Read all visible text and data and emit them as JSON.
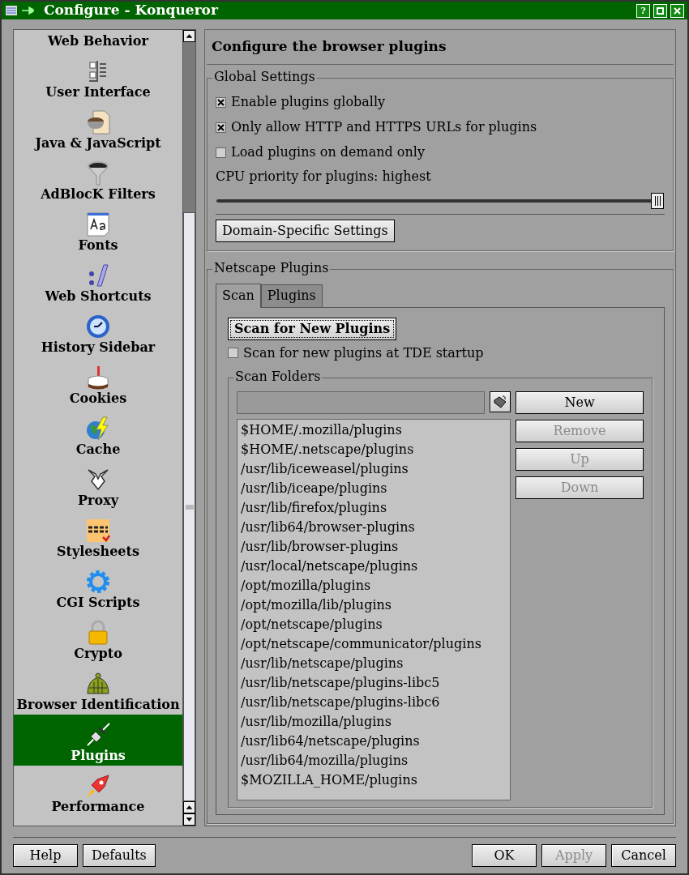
{
  "window": {
    "title": "Configure - Konqueror",
    "help_button": "?"
  },
  "sidebar": {
    "items": [
      {
        "label": "Web Behavior",
        "selected": false
      },
      {
        "label": "User Interface",
        "selected": false
      },
      {
        "label": "Java & JavaScript",
        "selected": false
      },
      {
        "label": "AdBlocK Filters",
        "selected": false
      },
      {
        "label": "Fonts",
        "selected": false
      },
      {
        "label": "Web Shortcuts",
        "selected": false
      },
      {
        "label": "History Sidebar",
        "selected": false
      },
      {
        "label": "Cookies",
        "selected": false
      },
      {
        "label": "Cache",
        "selected": false
      },
      {
        "label": "Proxy",
        "selected": false
      },
      {
        "label": "Stylesheets",
        "selected": false
      },
      {
        "label": "CGI Scripts",
        "selected": false
      },
      {
        "label": "Crypto",
        "selected": false
      },
      {
        "label": "Browser Identification",
        "selected": false
      },
      {
        "label": "Plugins",
        "selected": true
      },
      {
        "label": "Performance",
        "selected": false
      }
    ]
  },
  "page_title": "Configure the browser plugins",
  "global_settings": {
    "title": "Global Settings",
    "options": [
      {
        "label": "Enable plugins globally",
        "checked": true
      },
      {
        "label": "Only allow HTTP and HTTPS URLs for plugins",
        "checked": true
      },
      {
        "label": "Load plugins on demand only",
        "checked": false
      }
    ],
    "cpu_priority": {
      "label": "CPU priority for plugins: highest",
      "level": 1
    },
    "domain_button": "Domain-Specific Settings"
  },
  "netscape_plugins": {
    "title": "Netscape Plugins",
    "tabs": [
      {
        "label": "Scan",
        "selected": true
      },
      {
        "label": "Plugins",
        "selected": false
      }
    ],
    "scan_button": "Scan for New Plugins",
    "startup_option": {
      "label": "Scan for new plugins at TDE startup",
      "checked": false
    },
    "scan_folders": {
      "title": "Scan Folders",
      "buttons": [
        {
          "label": "New",
          "disabled": false
        },
        {
          "label": "Remove",
          "disabled": true
        },
        {
          "label": "Up",
          "disabled": true
        },
        {
          "label": "Down",
          "disabled": true
        }
      ],
      "folders": [
        "$HOME/.mozilla/plugins",
        "$HOME/.netscape/plugins",
        "/usr/lib/iceweasel/plugins",
        "/usr/lib/iceape/plugins",
        "/usr/lib/firefox/plugins",
        "/usr/lib64/browser-plugins",
        "/usr/lib/browser-plugins",
        "/usr/local/netscape/plugins",
        "/opt/mozilla/plugins",
        "/opt/mozilla/lib/plugins",
        "/opt/netscape/plugins",
        "/opt/netscape/communicator/plugins",
        "/usr/lib/netscape/plugins",
        "/usr/lib/netscape/plugins-libc5",
        "/usr/lib/netscape/plugins-libc6",
        "/usr/lib/mozilla/plugins",
        "/usr/lib64/netscape/plugins",
        "/usr/lib64/mozilla/plugins",
        "$MOZILLA_HOME/plugins"
      ]
    }
  },
  "left_buttons": [
    {
      "label": "Help",
      "disabled": false
    },
    {
      "label": "Defaults",
      "disabled": false
    }
  ],
  "right_buttons": [
    {
      "label": "OK",
      "disabled": false
    },
    {
      "label": "Apply",
      "disabled": true
    },
    {
      "label": "Cancel",
      "disabled": false
    }
  ]
}
